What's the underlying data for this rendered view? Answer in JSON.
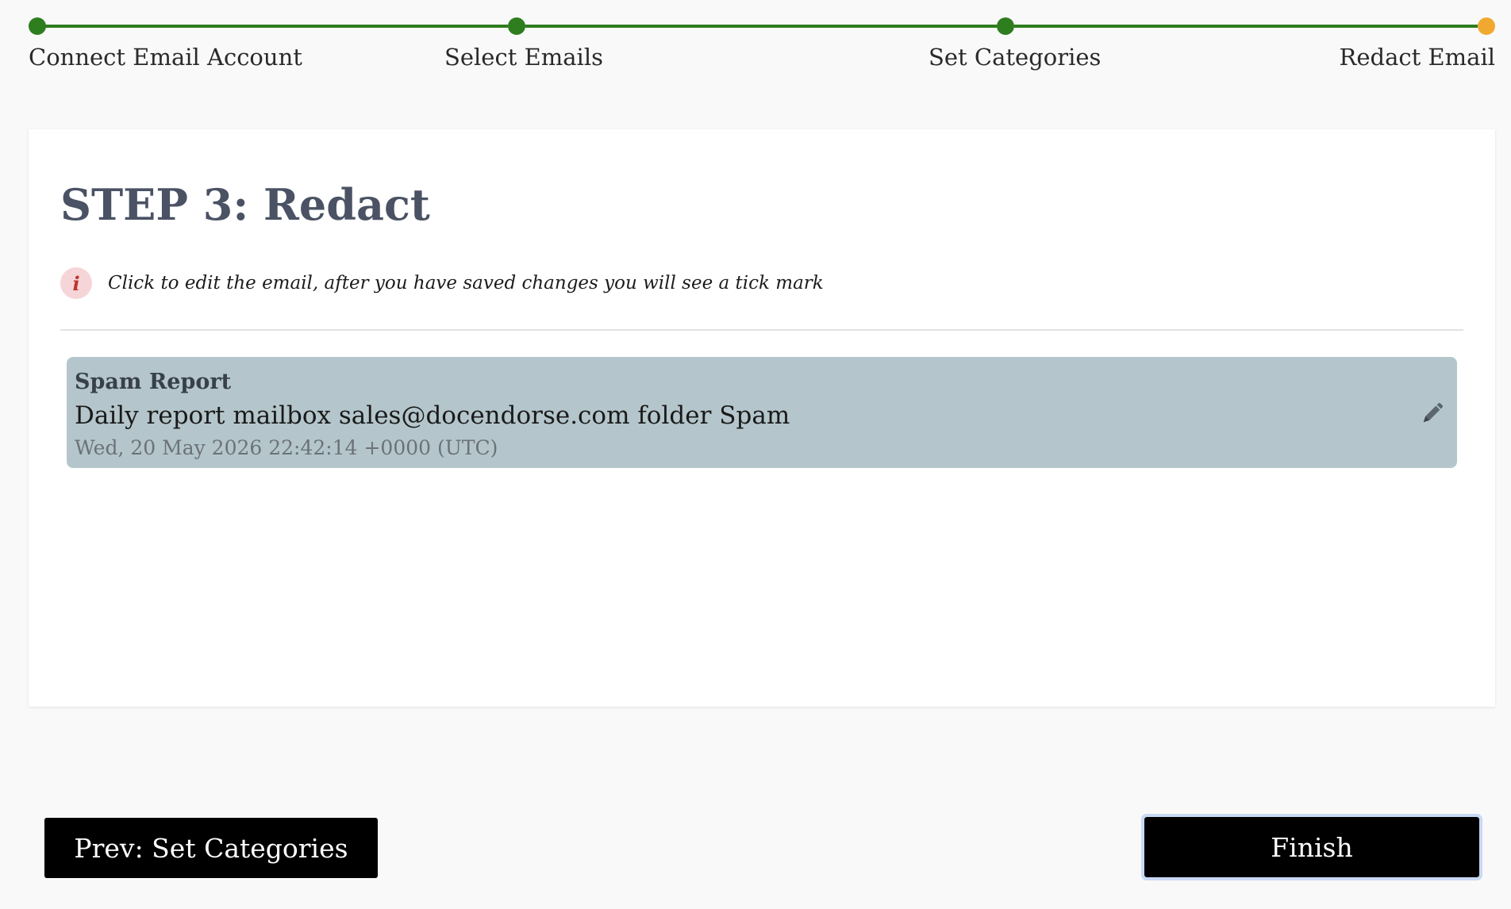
{
  "stepper": {
    "steps": [
      {
        "label": "Connect Email Account",
        "status": "completed"
      },
      {
        "label": "Select Emails",
        "status": "completed"
      },
      {
        "label": "Set Categories",
        "status": "completed"
      },
      {
        "label": "Redact Email",
        "status": "current"
      }
    ],
    "colors": {
      "completed": "#2e7d1e",
      "current": "#f0a830"
    }
  },
  "card": {
    "title": "STEP 3: Redact",
    "info": {
      "icon": "info-icon",
      "icon_glyph": "i",
      "text": "Click to edit the email, after you have saved changes you will see a tick mark"
    },
    "emails": [
      {
        "subject": "Spam Report",
        "snippet": "Daily report mailbox sales@docendorse.com folder Spam",
        "date": "Wed, 20 May 2026 22:42:14 +0000 (UTC)",
        "action_icon": "pen-icon"
      }
    ]
  },
  "footer": {
    "prev_label": "Prev: Set Categories",
    "finish_label": "Finish"
  }
}
